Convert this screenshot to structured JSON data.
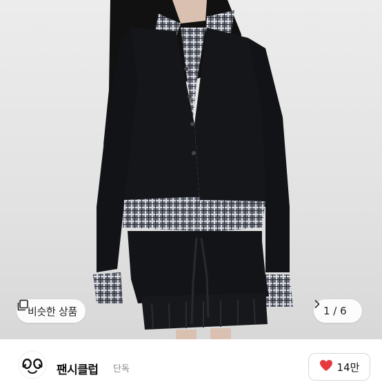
{
  "product_image": {
    "similar_button": {
      "icon": "similar-items-icon",
      "label": "비슷한 상품"
    },
    "pager": {
      "label": "1 / 6",
      "next_icon": "chevron-right-icon"
    }
  },
  "shop": {
    "logo_icon": "shop-logo-icon",
    "name": "팬시클럽",
    "badge": "단독"
  },
  "like": {
    "icon": "heart-icon",
    "count": "14만",
    "color": "#e6393e"
  }
}
